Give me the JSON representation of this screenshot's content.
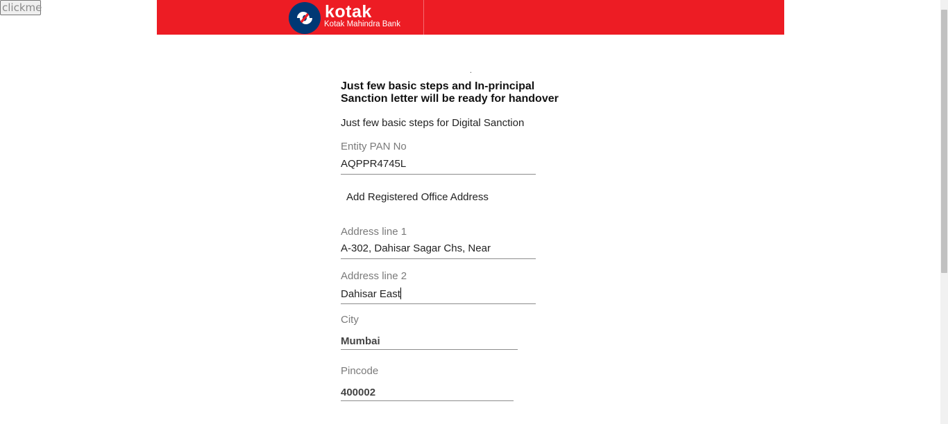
{
  "clickme_label": "clickme",
  "header": {
    "brand": "kotak",
    "brand_sub": "Kotak Mahindra Bank",
    "colors": {
      "bar": "#ed1c24",
      "logo_bg": "#003874"
    }
  },
  "dot": ".",
  "heading": "Just few basic steps and In-principal Sanction letter will be ready for handover",
  "subheading": "Just few basic steps for Digital Sanction",
  "fields": {
    "pan": {
      "label": "Entity PAN No",
      "value": "AQPPR4745L"
    },
    "section_title": "Add Registered Office Address",
    "address1": {
      "label": "Address line 1",
      "value": "A-302, Dahisar Sagar Chs, Near"
    },
    "address2": {
      "label": "Address line 2",
      "value": "Dahisar East"
    },
    "city": {
      "label": "City",
      "value": "Mumbai"
    },
    "pincode": {
      "label": "Pincode",
      "value": "400002"
    }
  }
}
